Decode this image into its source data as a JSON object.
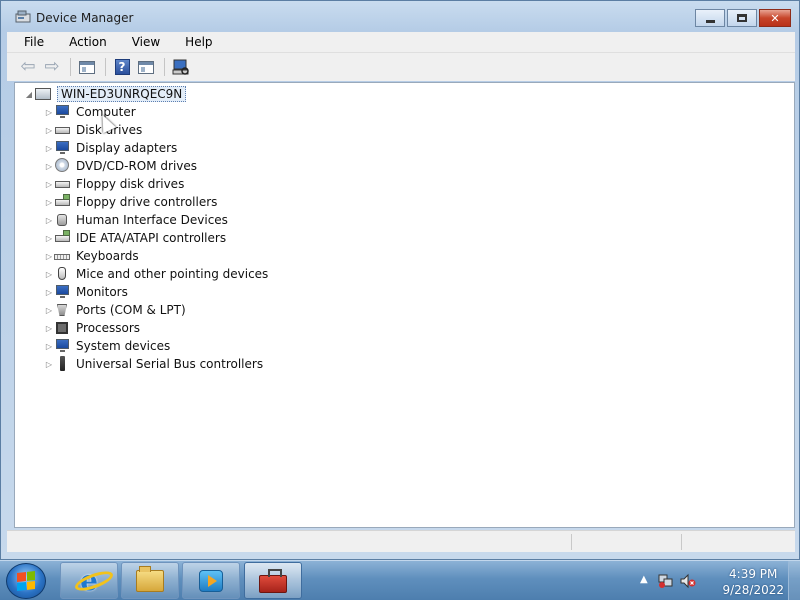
{
  "window": {
    "title": "Device Manager"
  },
  "menu": {
    "items": [
      "File",
      "Action",
      "View",
      "Help"
    ]
  },
  "toolbar": {
    "back_icon": "back-arrow-icon",
    "forward_icon": "forward-arrow-icon",
    "help_label": "?"
  },
  "tree": {
    "root_label": "WIN-ED3UNRQEC9N",
    "items": [
      {
        "label": "Computer",
        "icon": "computer-icon"
      },
      {
        "label": "Disk drives",
        "icon": "disk-drive-icon"
      },
      {
        "label": "Display adapters",
        "icon": "display-adapter-icon"
      },
      {
        "label": "DVD/CD-ROM drives",
        "icon": "dvd-drive-icon"
      },
      {
        "label": "Floppy disk drives",
        "icon": "floppy-drive-icon"
      },
      {
        "label": "Floppy drive controllers",
        "icon": "floppy-controller-icon"
      },
      {
        "label": "Human Interface Devices",
        "icon": "hid-icon"
      },
      {
        "label": "IDE ATA/ATAPI controllers",
        "icon": "ide-controller-icon"
      },
      {
        "label": "Keyboards",
        "icon": "keyboard-icon"
      },
      {
        "label": "Mice and other pointing devices",
        "icon": "mouse-icon"
      },
      {
        "label": "Monitors",
        "icon": "monitor-icon"
      },
      {
        "label": "Ports (COM & LPT)",
        "icon": "port-icon"
      },
      {
        "label": "Processors",
        "icon": "processor-icon"
      },
      {
        "label": "System devices",
        "icon": "system-devices-icon"
      },
      {
        "label": "Universal Serial Bus controllers",
        "icon": "usb-icon"
      }
    ]
  },
  "taskbar": {
    "time": "4:39 PM",
    "date": "9/28/2022",
    "tray_expand_label": "▲"
  },
  "colors": {
    "taskbar": "#5f8fbd",
    "close_button": "#c7452a",
    "selection": "#e3edf8"
  }
}
